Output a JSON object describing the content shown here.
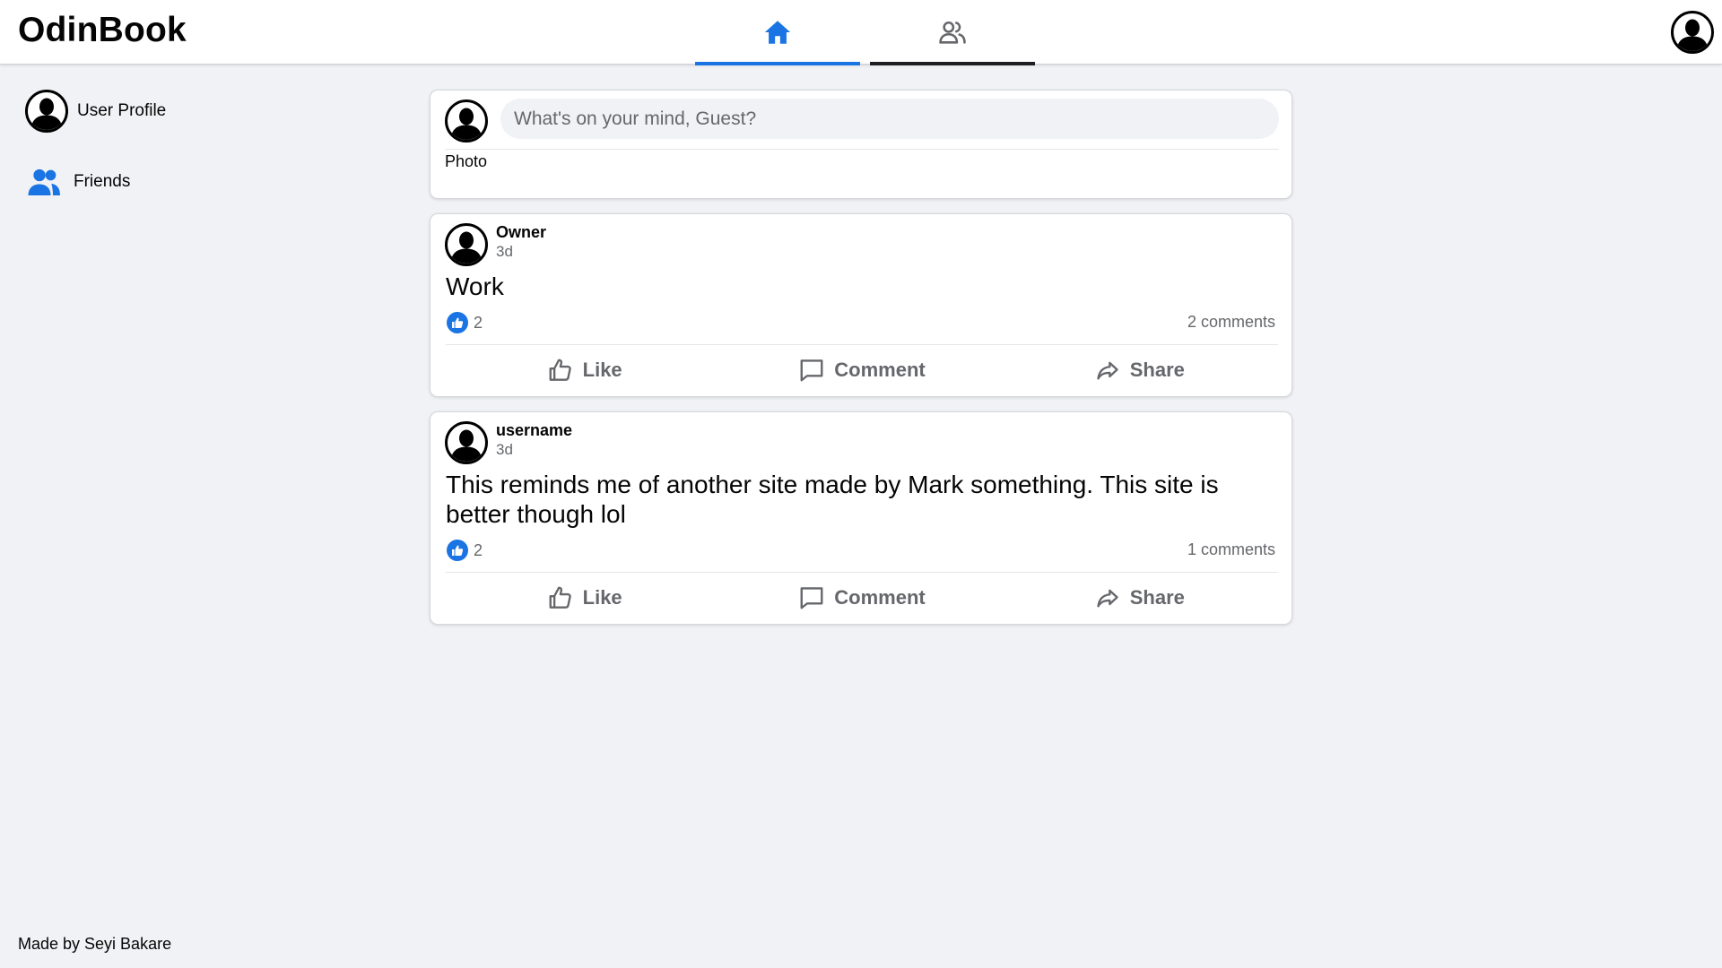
{
  "header": {
    "logo": "OdinBook",
    "tabs": [
      {
        "name": "home",
        "icon": "home-icon",
        "active": true
      },
      {
        "name": "friends",
        "icon": "friends-icon",
        "active": false
      }
    ],
    "avatar_icon": "user-avatar-icon"
  },
  "sidebar": {
    "items": [
      {
        "label": "User Profile",
        "icon": "user-avatar-icon"
      },
      {
        "label": "Friends",
        "icon": "friends-icon"
      }
    ]
  },
  "composer": {
    "placeholder": "What's on your mind, Guest?",
    "photo_label": "Photo"
  },
  "posts": [
    {
      "author": "Owner",
      "time": "3d",
      "text": "Work",
      "likes": "2",
      "comments": "2 comments",
      "actions": {
        "like": "Like",
        "comment": "Comment",
        "share": "Share"
      }
    },
    {
      "author": "username",
      "time": "3d",
      "text": "This reminds me of another site made by Mark something. This site is better though lol",
      "likes": "2",
      "comments": "1 comments",
      "actions": {
        "like": "Like",
        "comment": "Comment",
        "share": "Share"
      }
    }
  ],
  "footer": {
    "text": "Made by Seyi Bakare"
  },
  "colors": {
    "accent": "#1b74e4",
    "background": "#f0f2f5",
    "card": "#ffffff",
    "muted_text": "#65676b"
  }
}
